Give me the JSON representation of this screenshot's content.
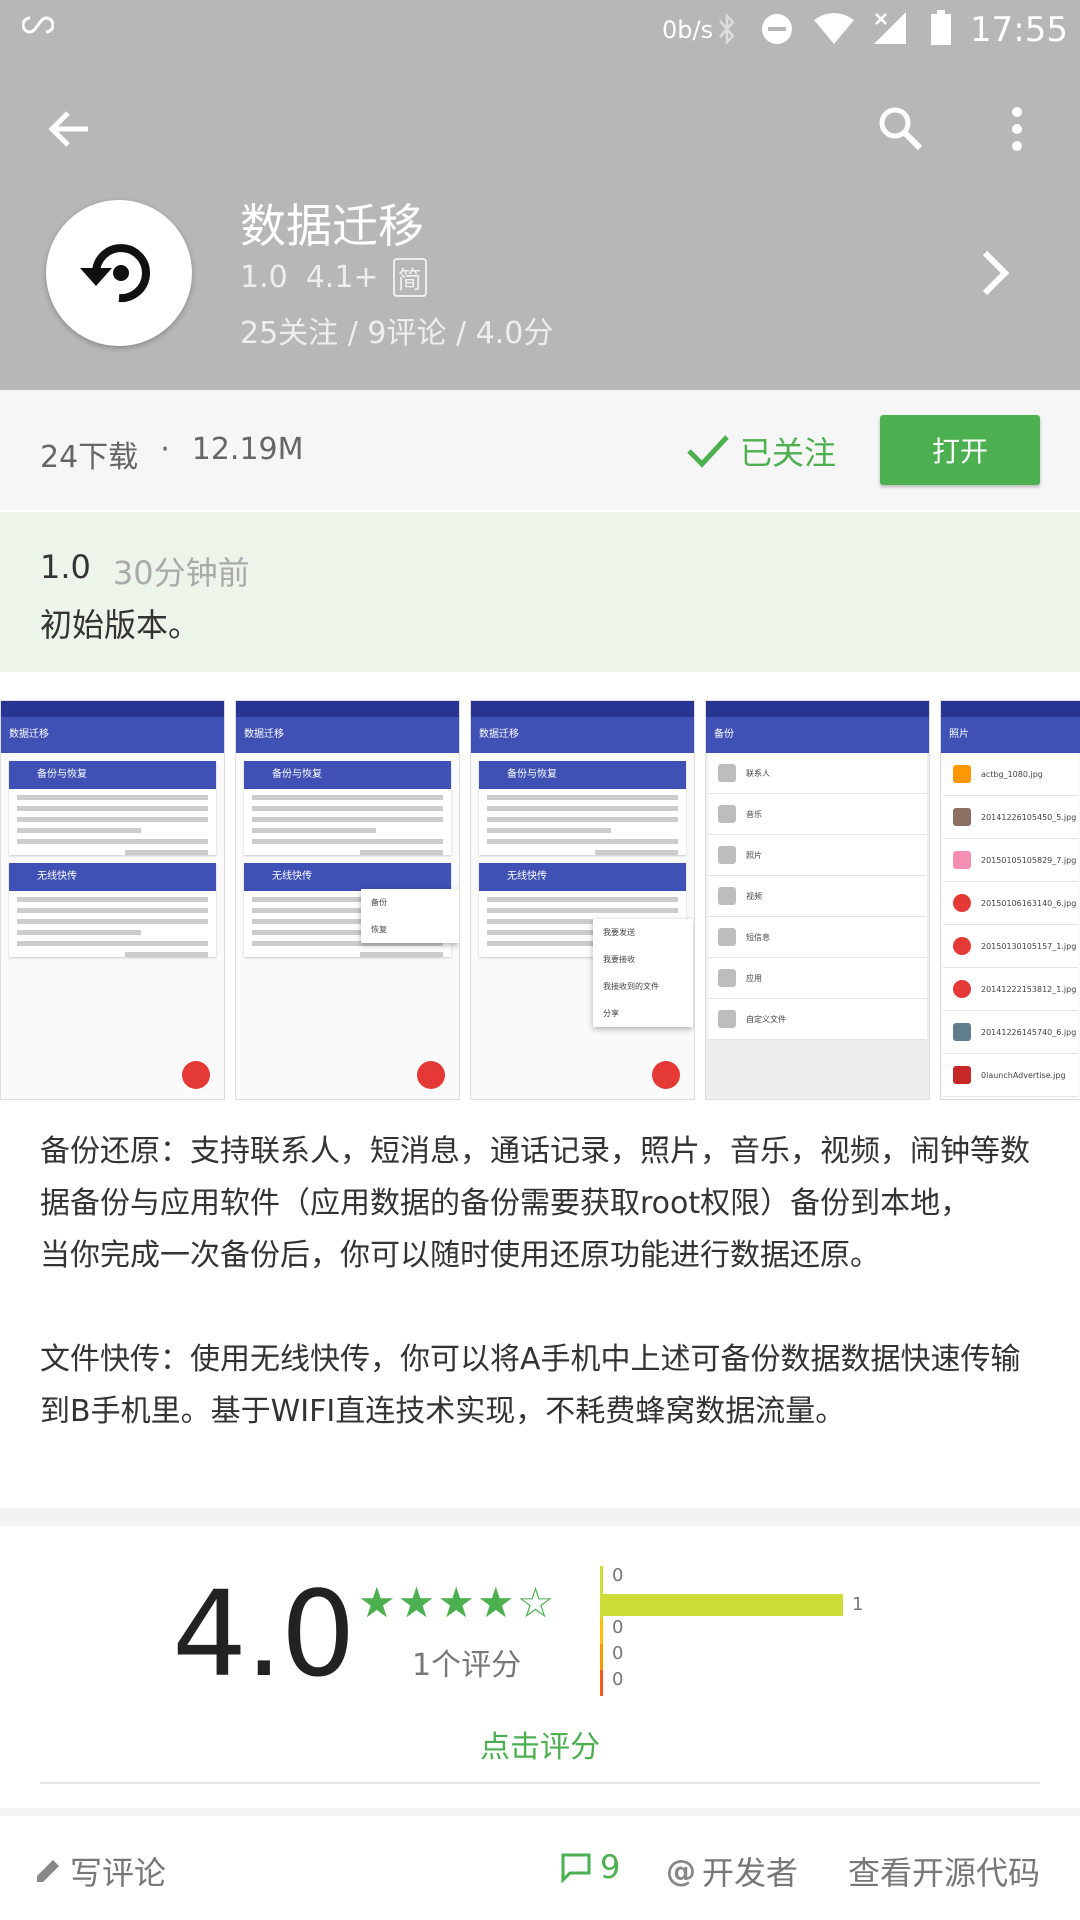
{
  "status_bar": {
    "net_speed": "0b/s",
    "time": "17:55"
  },
  "app": {
    "name": "数据迁移",
    "version": "1.0",
    "min_android": "4.1+",
    "lang_badge": "简",
    "stats": "25关注 / 9评论 / 4.0分"
  },
  "download": {
    "count": "24下载",
    "dot": "·",
    "size": "12.19M",
    "followed_label": "已关注",
    "open_label": "打开"
  },
  "changelog": {
    "version": "1.0",
    "time": "30分钟前",
    "text": "初始版本。"
  },
  "screenshots": {
    "s1": {
      "title": "数据迁移",
      "card1": "备份与恢复",
      "card2": "无线快传"
    },
    "s2": {
      "title": "数据迁移",
      "card1": "备份与恢复",
      "card2": "无线快传",
      "menu": [
        "备份",
        "恢复"
      ]
    },
    "s3": {
      "title": "数据迁移",
      "card1": "备份与恢复",
      "card2": "无线快传",
      "menu": [
        "我要发送",
        "我要接收",
        "我接收到的文件",
        "分享"
      ]
    },
    "s4": {
      "title": "备份",
      "rows": [
        "联系人",
        "音乐",
        "照片",
        "视频",
        "短信息",
        "应用",
        "自定义文件"
      ]
    },
    "s5": {
      "title": "照片",
      "rows": [
        "actbg_1080.jpg",
        "20141226105450_5.jpg",
        "20150105105829_7.jpg",
        "20150106163140_6.jpg",
        "20150130105157_1.jpg",
        "20141222153812_1.jpg",
        "20141226145740_6.jpg",
        "0launchAdvertise.jpg"
      ]
    }
  },
  "description": {
    "p1": "备份还原：支持联系人，短消息，通话记录，照片，音乐，视频，闹钟等数据备份与应用软件（应用数据的备份需要获取root权限）备份到本地，",
    "p2": "当你完成一次备份后，你可以随时使用还原功能进行数据还原。",
    "p3": "文件快传：使用无线快传，你可以将A手机中上述可备份数据数据快速传输到B手机里。基于WIFI直连技术实现，不耗费蜂窝数据流量。"
  },
  "rating": {
    "score": "4.0",
    "stars_value": 4,
    "stars_max": 5,
    "count_label": "1个评分",
    "rate_label": "点击评分",
    "bars": [
      {
        "label": "0",
        "value": 0,
        "color": "#cddc39"
      },
      {
        "label": "1",
        "value": 1,
        "color": "#cddc39"
      },
      {
        "label": "0",
        "value": 0,
        "color": "#ffc107"
      },
      {
        "label": "0",
        "value": 0,
        "color": "#ff9800"
      },
      {
        "label": "0",
        "value": 0,
        "color": "#ff5722"
      }
    ]
  },
  "bottom_bar": {
    "write_review": "写评论",
    "comments_count": "9",
    "developer": "开发者",
    "source_code": "查看开源代码"
  },
  "colors": {
    "accent": "#4caf50",
    "header_bg": "#b7b7b7"
  }
}
